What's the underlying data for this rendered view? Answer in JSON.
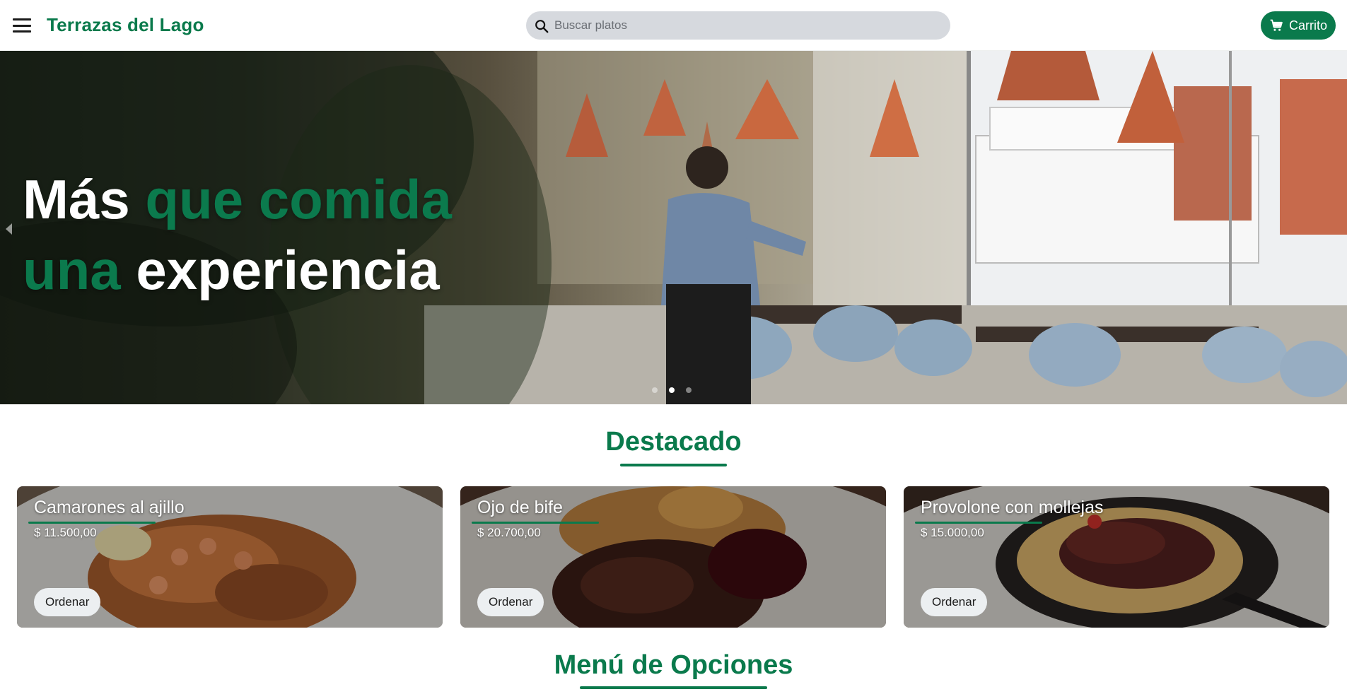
{
  "header": {
    "brand": "Terrazas del Lago",
    "search_placeholder": "Buscar platos",
    "search_value": "",
    "cart_label": "Carrito"
  },
  "hero": {
    "title_line1_white": "Más",
    "title_line1_green": "que comida",
    "title_line2_green": "una",
    "title_line2_white": "experiencia",
    "slide_count": 3,
    "active_slide": 2
  },
  "featured": {
    "title": "Destacado",
    "items": [
      {
        "name": "Camarones al ajillo",
        "price": "$ 11.500,00",
        "button": "Ordenar"
      },
      {
        "name": "Ojo de bife",
        "price": "$ 20.700,00",
        "button": "Ordenar"
      },
      {
        "name": "Provolone con mollejas",
        "price": "$ 15.000,00",
        "button": "Ordenar"
      }
    ]
  },
  "menu": {
    "title": "Menú de Opciones"
  },
  "colors": {
    "brand_green": "#0a7a4c",
    "search_bg": "#d6d9de",
    "button_light": "#eceff1"
  },
  "icons": {
    "menu": "hamburger-icon",
    "search": "search-icon",
    "cart": "cart-icon",
    "carousel_prev": "chevron-left-icon"
  }
}
